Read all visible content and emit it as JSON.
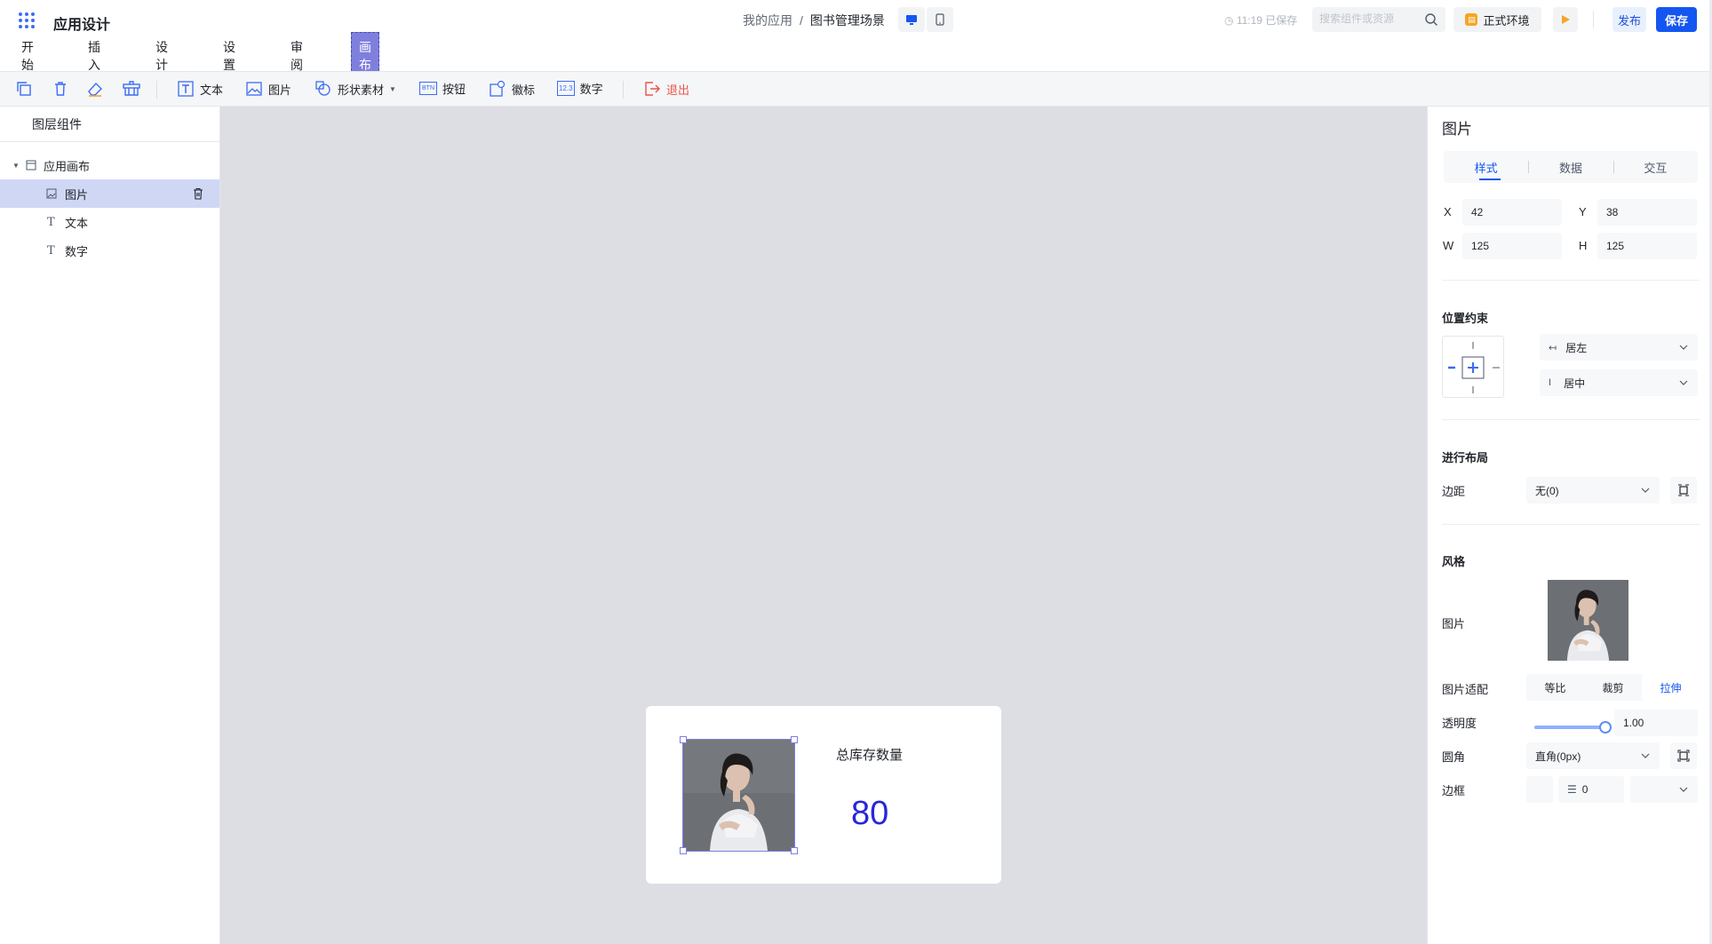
{
  "header": {
    "app_title": "应用设计",
    "breadcrumb_root": "我的应用",
    "breadcrumb_sep": "/",
    "breadcrumb_current": "图书管理场景",
    "save_status": "11:19 已保存",
    "search_placeholder": "搜索组件或资源",
    "env_label": "正式环境",
    "publish_label": "发布",
    "save_label": "保存"
  },
  "menu_tabs": [
    "开始",
    "插入",
    "设计",
    "设置",
    "审阅",
    "画布"
  ],
  "toolbar": {
    "text": "文本",
    "image": "图片",
    "shape": "形状素材",
    "button": "按钮",
    "badge": "徽标",
    "number": "数字",
    "exit": "退出",
    "button_icon_text": "BTN",
    "number_icon_text": "12.3"
  },
  "layers": {
    "title": "图层组件",
    "root": "应用画布",
    "items": [
      "图片",
      "文本",
      "数字"
    ]
  },
  "canvas": {
    "card_label": "总库存数量",
    "card_value": "80"
  },
  "props": {
    "title": "图片",
    "tabs": [
      "样式",
      "数据",
      "交互"
    ],
    "x_label": "X",
    "x": "42",
    "y_label": "Y",
    "y": "38",
    "w_label": "W",
    "w": "125",
    "h_label": "H",
    "h": "125",
    "constraint_title": "位置约束",
    "h_constraint": "居左",
    "v_constraint": "居中",
    "layout_title": "进行布局",
    "margin_label": "边距",
    "margin_value": "无(0)",
    "style_title": "风格",
    "image_label": "图片",
    "fit_label": "图片适配",
    "fit_options": [
      "等比",
      "裁剪",
      "拉伸"
    ],
    "fit_selected": "拉伸",
    "opacity_label": "透明度",
    "opacity_value": "1.00",
    "opacity_level": 1.0,
    "radius_label": "圆角",
    "radius_value": "直角(0px)",
    "border_label": "边框",
    "border_width": "0"
  },
  "colors": {
    "accent": "#1456f0",
    "canvas_tab": "#7f7fde",
    "number": "#2727d9",
    "exit": "#e8554e"
  }
}
